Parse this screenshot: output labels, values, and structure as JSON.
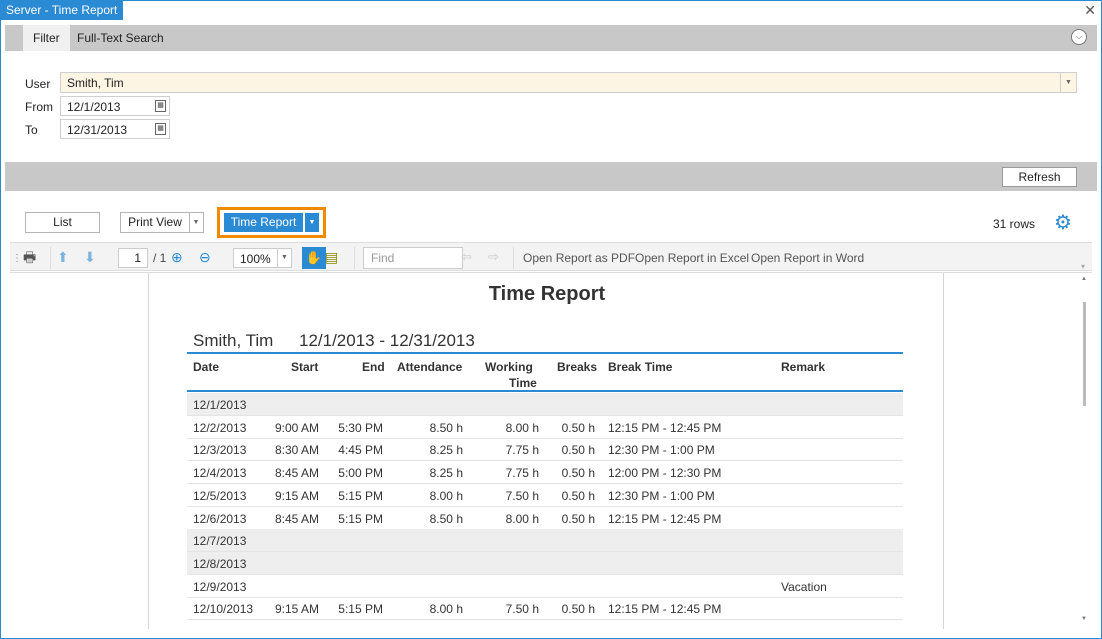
{
  "window": {
    "title": "Server - Time Report"
  },
  "filter_tabs": [
    {
      "label": "Filter"
    },
    {
      "label": "Full-Text Search"
    }
  ],
  "filter": {
    "user_label": "User",
    "user_value": "Smith, Tim",
    "from_label": "From",
    "from_value": "12/1/2013",
    "to_label": "To",
    "to_value": "12/31/2013"
  },
  "refresh_label": "Refresh",
  "views": {
    "list": "List",
    "print_view": "Print View",
    "time_report": "Time Report"
  },
  "rows_count": "31 rows",
  "toolbar": {
    "page": "1",
    "page_total": "/ 1",
    "zoom": "100%",
    "find_placeholder": "Find",
    "open_pdf": "Open Report as PDF",
    "open_excel": "Open Report in Excel",
    "open_word": "Open Report in Word"
  },
  "report": {
    "title": "Time Report",
    "user": "Smith, Tim",
    "period": "12/1/2013 - 12/31/2013",
    "columns": {
      "date": "Date",
      "start": "Start",
      "end": "End",
      "attendance": "Attendance",
      "working_1": "Working",
      "working_2": "Time",
      "breaks": "Breaks",
      "break_time": "Break Time",
      "remark": "Remark"
    },
    "rows": [
      {
        "date": "12/1/2013",
        "start": "",
        "end": "",
        "attendance": "",
        "working": "",
        "breaks": "",
        "break_time": "",
        "remark": "",
        "weekend": true
      },
      {
        "date": "12/2/2013",
        "start": "9:00 AM",
        "end": "5:30 PM",
        "attendance": "8.50 h",
        "working": "8.00 h",
        "breaks": "0.50 h",
        "break_time": "12:15 PM - 12:45 PM",
        "remark": "",
        "weekend": false
      },
      {
        "date": "12/3/2013",
        "start": "8:30 AM",
        "end": "4:45 PM",
        "attendance": "8.25 h",
        "working": "7.75 h",
        "breaks": "0.50 h",
        "break_time": "12:30 PM - 1:00 PM",
        "remark": "",
        "weekend": false
      },
      {
        "date": "12/4/2013",
        "start": "8:45 AM",
        "end": "5:00 PM",
        "attendance": "8.25 h",
        "working": "7.75 h",
        "breaks": "0.50 h",
        "break_time": "12:00 PM - 12:30 PM",
        "remark": "",
        "weekend": false
      },
      {
        "date": "12/5/2013",
        "start": "9:15 AM",
        "end": "5:15 PM",
        "attendance": "8.00 h",
        "working": "7.50 h",
        "breaks": "0.50 h",
        "break_time": "12:30 PM - 1:00 PM",
        "remark": "",
        "weekend": false
      },
      {
        "date": "12/6/2013",
        "start": "8:45 AM",
        "end": "5:15 PM",
        "attendance": "8.50 h",
        "working": "8.00 h",
        "breaks": "0.50 h",
        "break_time": "12:15 PM - 12:45 PM",
        "remark": "",
        "weekend": false
      },
      {
        "date": "12/7/2013",
        "start": "",
        "end": "",
        "attendance": "",
        "working": "",
        "breaks": "",
        "break_time": "",
        "remark": "",
        "weekend": true
      },
      {
        "date": "12/8/2013",
        "start": "",
        "end": "",
        "attendance": "",
        "working": "",
        "breaks": "",
        "break_time": "",
        "remark": "",
        "weekend": true
      },
      {
        "date": "12/9/2013",
        "start": "",
        "end": "",
        "attendance": "",
        "working": "",
        "breaks": "",
        "break_time": "",
        "remark": "Vacation",
        "weekend": false
      },
      {
        "date": "12/10/2013",
        "start": "9:15 AM",
        "end": "5:15 PM",
        "attendance": "8.00 h",
        "working": "7.50 h",
        "breaks": "0.50 h",
        "break_time": "12:15 PM - 12:45 PM",
        "remark": "",
        "weekend": false
      }
    ]
  },
  "colors": {
    "accent": "#2a8ad4",
    "highlight": "#f08a00",
    "user_field_bg": "#fdf5e4"
  }
}
